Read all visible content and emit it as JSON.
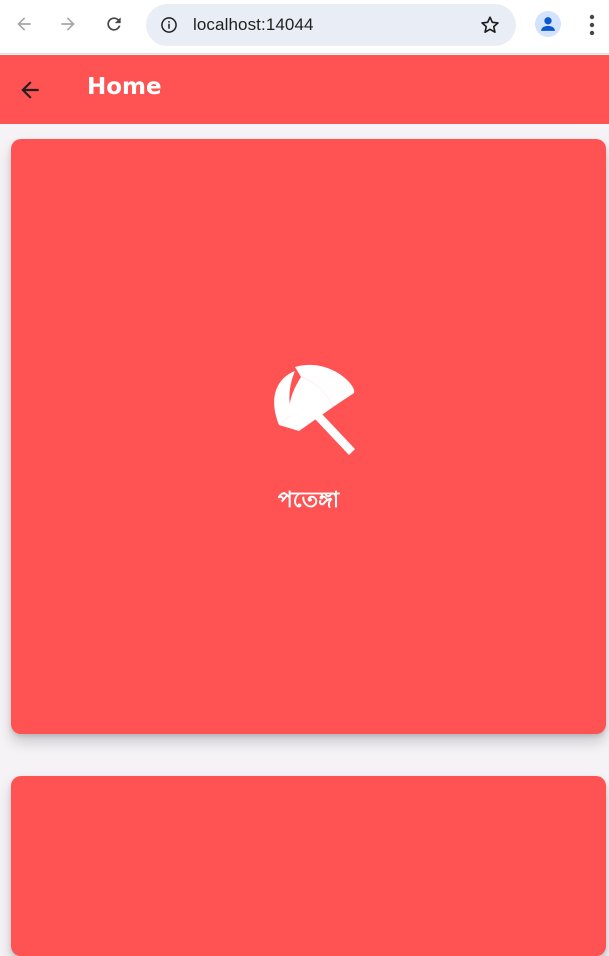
{
  "browser": {
    "url": "localhost:14044",
    "icons": {
      "back": "back-arrow-icon",
      "forward": "forward-arrow-icon",
      "reload": "reload-icon",
      "site_info": "info-icon",
      "bookmark": "star-icon",
      "profile": "person-icon",
      "menu": "three-dots-icon"
    }
  },
  "app_bar": {
    "title": "Home",
    "background": "#ff5252"
  },
  "cards": [
    {
      "label": "পতেঙ্গা",
      "icon": "beach-umbrella-icon"
    },
    {
      "label": "",
      "icon": ""
    }
  ],
  "colors": {
    "accent": "#ff5252",
    "page_background": "#f6f3f7"
  }
}
